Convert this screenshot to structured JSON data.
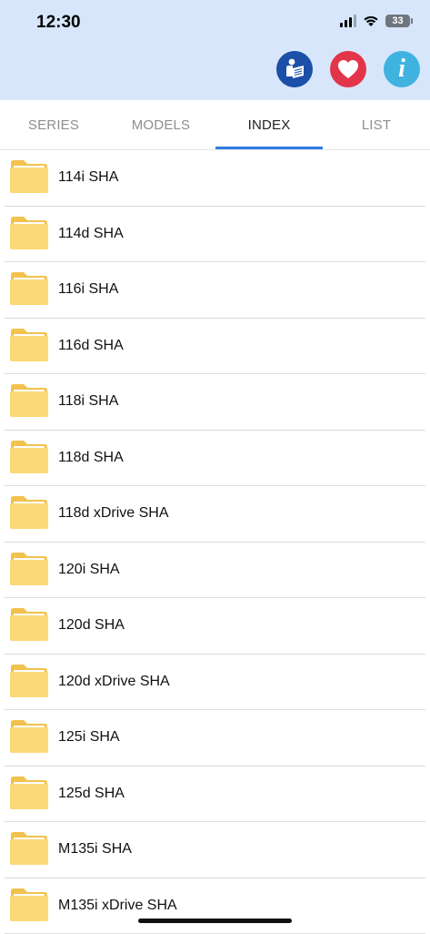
{
  "status_bar": {
    "time": "12:30",
    "battery": "33",
    "icons": [
      "signal-icon",
      "wifi-icon",
      "battery-icon"
    ]
  },
  "header_actions": [
    {
      "name": "manual-icon",
      "color": "#1b4fa8"
    },
    {
      "name": "heart-icon",
      "color": "#e3354a"
    },
    {
      "name": "info-icon",
      "color": "#3fb2e0",
      "glyph": "i"
    }
  ],
  "tabs": [
    {
      "label": "SERIES",
      "active": false
    },
    {
      "label": "MODELS",
      "active": false
    },
    {
      "label": "INDEX",
      "active": true
    },
    {
      "label": "LIST",
      "active": false
    }
  ],
  "colors": {
    "header_bg": "#d7e6fb",
    "tab_indicator": "#2f7de1",
    "folder": "#fbd978"
  },
  "items": [
    {
      "label": "114i SHA"
    },
    {
      "label": "114d SHA"
    },
    {
      "label": "116i SHA"
    },
    {
      "label": "116d SHA"
    },
    {
      "label": "118i SHA"
    },
    {
      "label": "118d SHA"
    },
    {
      "label": "118d xDrive SHA"
    },
    {
      "label": "120i SHA"
    },
    {
      "label": "120d SHA"
    },
    {
      "label": "120d xDrive SHA"
    },
    {
      "label": "125i SHA"
    },
    {
      "label": "125d SHA"
    },
    {
      "label": "M135i SHA"
    },
    {
      "label": "M135i xDrive SHA"
    }
  ]
}
